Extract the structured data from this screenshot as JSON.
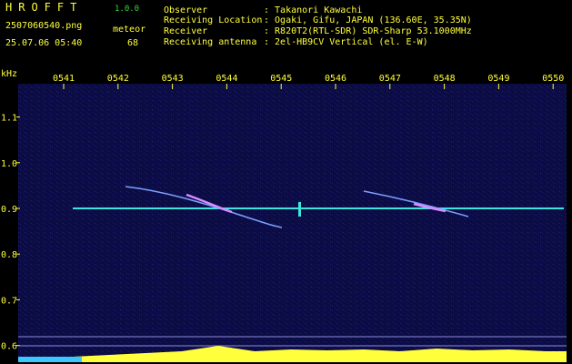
{
  "app": {
    "title": "HROFFT",
    "version": "1.0.0"
  },
  "file": {
    "name": "2507060540.png",
    "timestamp": "25.07.06 05:40"
  },
  "detection": {
    "label": "meteor",
    "count": "68"
  },
  "station": {
    "rows": [
      {
        "label": "Observer",
        "value": ": Takanori Kawachi"
      },
      {
        "label": "Receiving Location",
        "value": ": Ogaki, Gifu, JAPAN (136.60E, 35.35N)"
      },
      {
        "label": "Receiver",
        "value": ": R820T2(RTL-SDR) SDR-Sharp 53.1000MHz"
      },
      {
        "label": "Receiving antenna",
        "value": ": 2el-HB9CV Vertical (el. E-W)"
      }
    ]
  },
  "spectrogram": {
    "y_unit": "kHz",
    "y_ticks": [
      "1.1",
      "1.0",
      "0.9",
      "0.8",
      "0.7",
      "0.6"
    ],
    "y_tick_values": [
      1.1,
      1.0,
      0.9,
      0.8,
      0.7,
      0.6
    ],
    "x_ticks": [
      "0541",
      "0542",
      "0543",
      "0544",
      "0545",
      "0546",
      "0547",
      "0548",
      "0549",
      "0550"
    ],
    "colors": {
      "background": "#0a0a3c",
      "carrier": "#3ce6dc",
      "text": "#ffff3c",
      "accent": "#34d83c",
      "echo": "#c878ff"
    }
  }
}
